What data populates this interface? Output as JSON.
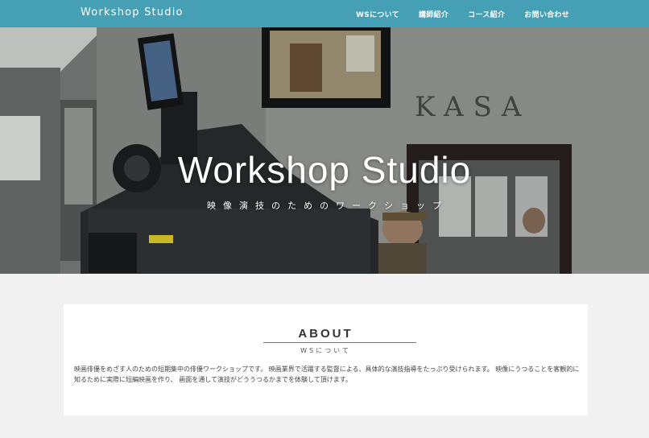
{
  "header": {
    "brand": "Workshop Studio",
    "nav": [
      {
        "label": "WSについて"
      },
      {
        "label": "講師紹介"
      },
      {
        "label": "コース紹介"
      },
      {
        "label": "お問い合わせ"
      }
    ],
    "bar_color": "#45a0b5"
  },
  "hero": {
    "title": "Workshop Studio",
    "subtitle": "映像演技のためのワークショップ",
    "sign_text": "KASA"
  },
  "about": {
    "heading": "ABOUT",
    "subheading": "WSについて",
    "body": "映画俳優をめざす人のための短期集中の俳優ワークショップです。 映画業界で活躍する監督による、具体的な演技指導をたっぷり受けられます。 映像にうつることを客観的に知るために実際に短編映画を作り、 画面を通して演技がどううつるかまでを体験して頂けます。"
  }
}
